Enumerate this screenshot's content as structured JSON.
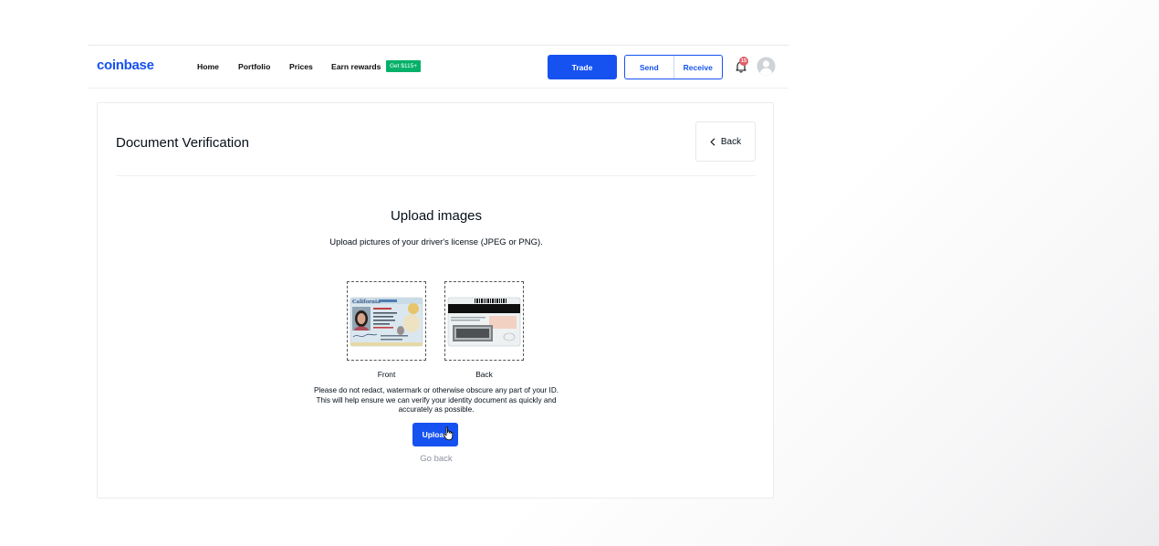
{
  "header": {
    "logo": "coinbase",
    "nav": [
      "Home",
      "Portfolio",
      "Prices",
      "Earn rewards"
    ],
    "earn_badge": "Get $115+",
    "trade": "Trade",
    "send": "Send",
    "receive": "Receive",
    "notification_count": "15",
    "icons": [
      "bell-icon",
      "avatar-icon"
    ]
  },
  "card": {
    "title": "Document Verification",
    "back": "Back",
    "upload_title": "Upload images",
    "upload_subtitle": "Upload pictures of your driver's license (JPEG or PNG).",
    "front_label": "Front",
    "back_label": "Back",
    "front_id_state": "California",
    "notice": "Please do not redact, watermark or otherwise obscure any part of your ID. This will help ensure we can verify your identity document as quickly and accurately as possible.",
    "upload_button": "Upload",
    "go_back": "Go back"
  },
  "colors": {
    "brand": "#1652f0",
    "badge_green": "#05b169",
    "notification_red": "#df5f67"
  }
}
